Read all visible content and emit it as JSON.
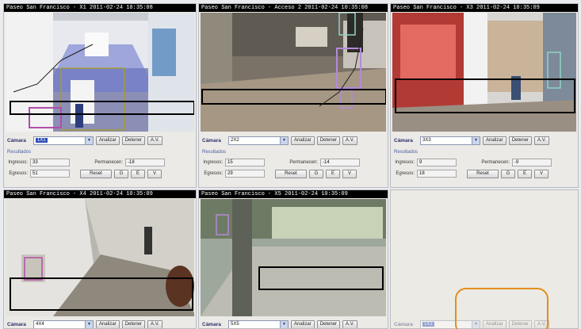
{
  "panels": [
    {
      "title": "Paseo San Francisco - X1  2011-02-24 10:35:08",
      "camera_label": "Cámara",
      "camera_value": "1X1",
      "buttons": {
        "analizar": "Analizar",
        "detener": "Detener",
        "av": "A.V."
      },
      "results": {
        "heading": "Resultados",
        "ingresos_label": "Ingresos:",
        "ingresos": "33",
        "permanecen_label": "Permanecen:",
        "permanecen": "-18",
        "egresos_label": "Egresos:",
        "egresos": "51"
      },
      "actions": {
        "reset": "Reset",
        "g": "G",
        "e": "E",
        "v": "V"
      }
    },
    {
      "title": "Paseo San Francisco - Acceso 2  2011-02-24 10:35:08",
      "camera_label": "Cámara",
      "camera_value": "2X2",
      "buttons": {
        "analizar": "Analizar",
        "detener": "Detener",
        "av": "A.V."
      },
      "results": {
        "heading": "Resultados",
        "ingresos_label": "Ingresos:",
        "ingresos": "15",
        "permanecen_label": "Permanecen:",
        "permanecen": "-14",
        "egresos_label": "Egresos:",
        "egresos": "29"
      },
      "actions": {
        "reset": "Reset",
        "g": "G",
        "e": "E",
        "v": "V"
      }
    },
    {
      "title": "Paseo San Francisco - X3  2011-02-24 10:35:09",
      "camera_label": "Cámara",
      "camera_value": "3X3",
      "buttons": {
        "analizar": "Analizar",
        "detener": "Detener",
        "av": "A.V."
      },
      "results": {
        "heading": "Resultados",
        "ingresos_label": "Ingresos:",
        "ingresos": "9",
        "permanecen_label": "Permanecen:",
        "permanecen": "-9",
        "egresos_label": "Egresos:",
        "egresos": "18"
      },
      "actions": {
        "reset": "Reset",
        "g": "G",
        "e": "E",
        "v": "V"
      }
    },
    {
      "title": "Paseo San Francisco - X4  2011-02-24 10:35:09",
      "camera_label": "Cámara",
      "camera_value": "4X4",
      "buttons": {
        "analizar": "Analizar",
        "detener": "Detener",
        "av": "A.V."
      }
    },
    {
      "title": "Paseo San Francisco - X5  2011-02-24 10:35:09",
      "camera_label": "Cámara",
      "camera_value": "5X5",
      "buttons": {
        "analizar": "Analizar",
        "detener": "Detener",
        "av": "A.V."
      }
    },
    {
      "title": "",
      "camera_label": "Cámara",
      "camera_value": "1X1",
      "buttons": {
        "analizar": "Analizar",
        "detener": "Detener",
        "av": "A.V."
      }
    }
  ],
  "colors": {
    "highlight_ring": "#e38f1d",
    "detection_box": "#8fd3c4",
    "person_box": "#b48ad8",
    "zone_line": "#000000"
  }
}
